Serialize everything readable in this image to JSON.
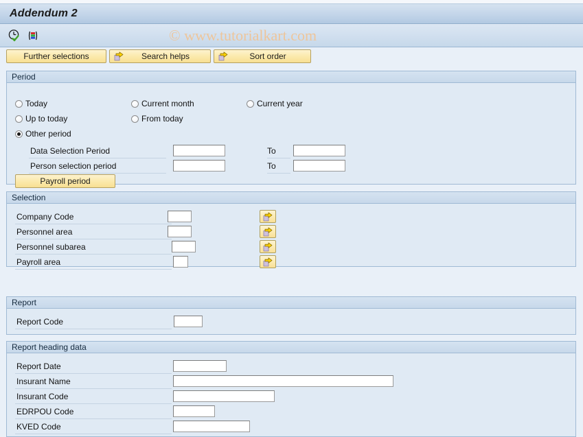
{
  "window": {
    "title": "Addendum 2"
  },
  "toolbar": {
    "execute_icon": "clock-check-icon",
    "variant_icon": "color-bars-icon",
    "watermark": "© www.tutorialkart.com"
  },
  "buttonbar": {
    "buttons": [
      {
        "label": "Further selections",
        "icon": null
      },
      {
        "label": "Search helps",
        "icon": "arrow-right-icon"
      },
      {
        "label": "Sort order",
        "icon": "arrow-right-icon"
      }
    ]
  },
  "period": {
    "header": "Period",
    "radios": [
      {
        "label": "Today",
        "selected": false
      },
      {
        "label": "Current month",
        "selected": false
      },
      {
        "label": "Current year",
        "selected": false
      },
      {
        "label": "Up to today",
        "selected": false
      },
      {
        "label": "From today",
        "selected": false
      },
      {
        "label": "Other period",
        "selected": true
      }
    ],
    "fields": [
      {
        "label": "Data Selection Period",
        "value": "",
        "to_label": "To",
        "to_value": ""
      },
      {
        "label": "Person selection period",
        "value": "",
        "to_label": "To",
        "to_value": ""
      }
    ],
    "payroll_button": "Payroll period"
  },
  "selection": {
    "header": "Selection",
    "rows": [
      {
        "label": "Company Code",
        "value": "",
        "select_icon": "arrow-right-icon"
      },
      {
        "label": "Personnel area",
        "value": "",
        "select_icon": "arrow-right-icon"
      },
      {
        "label": "Personnel subarea",
        "value": "",
        "select_icon": "arrow-right-icon"
      },
      {
        "label": "Payroll area",
        "value": "",
        "select_icon": "arrow-right-icon"
      }
    ]
  },
  "report": {
    "header": "Report",
    "rows": [
      {
        "label": "Report Code",
        "value": ""
      }
    ]
  },
  "report_heading": {
    "header": "Report heading data",
    "rows": [
      {
        "label": "Report Date",
        "value": ""
      },
      {
        "label": "Insurant Name",
        "value": ""
      },
      {
        "label": "Insurant Code",
        "value": ""
      },
      {
        "label": "EDRPOU Code",
        "value": ""
      },
      {
        "label": "KVED Code",
        "value": ""
      }
    ]
  },
  "colors": {
    "title_bar": "#c3d5e9",
    "group_header": "#cbdbec",
    "group_body": "#e0eaf4",
    "button_yellow": "#fbeaad",
    "page_background": "#e9f0f8",
    "watermark": "#eec59a"
  }
}
